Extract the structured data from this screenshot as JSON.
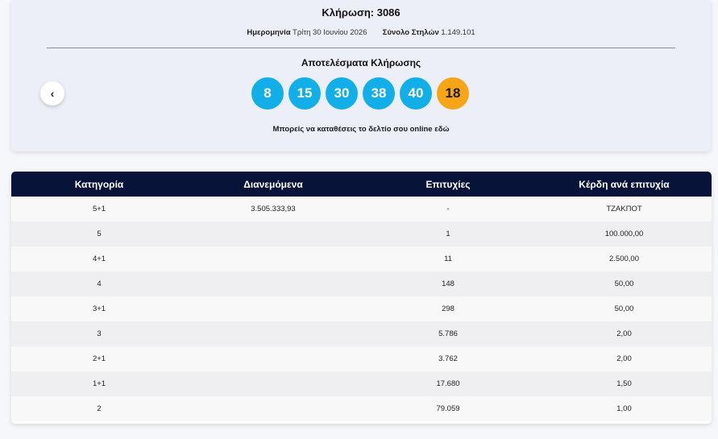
{
  "draw": {
    "title": "Κλήρωση: 3086",
    "date_label": "Ημερομηνία",
    "date_value": "Τρίτη 30 Ιουνίου 2026",
    "columns_label": "Σύνολο Στηλών",
    "columns_value": "1.149.101",
    "results_title": "Αποτελέσματα Κλήρωσης",
    "numbers": [
      "8",
      "15",
      "30",
      "38",
      "40"
    ],
    "bonus": "18",
    "prev_icon": "chevron-left-icon",
    "prev_glyph": "‹",
    "online_link": "Μπορείς να καταθέσεις το δελτίο σου online εδώ",
    "colors": {
      "ball": "#12aee8",
      "bonus": "#f5a516",
      "header": "#08133a"
    }
  },
  "table": {
    "headers": [
      "Κατηγορία",
      "Διανεμόμενα",
      "Επιτυχίες",
      "Κέρδη ανά επιτυχία"
    ],
    "rows": [
      [
        "5+1",
        "3.505.333,93",
        "-",
        "ΤΖΑΚΠΟΤ"
      ],
      [
        "5",
        "",
        "1",
        "100.000,00"
      ],
      [
        "4+1",
        "",
        "11",
        "2.500,00"
      ],
      [
        "4",
        "",
        "148",
        "50,00"
      ],
      [
        "3+1",
        "",
        "298",
        "50,00"
      ],
      [
        "3",
        "",
        "5.786",
        "2,00"
      ],
      [
        "2+1",
        "",
        "3.762",
        "2,00"
      ],
      [
        "1+1",
        "",
        "17.680",
        "1,50"
      ],
      [
        "2",
        "",
        "79.059",
        "1,00"
      ]
    ]
  }
}
